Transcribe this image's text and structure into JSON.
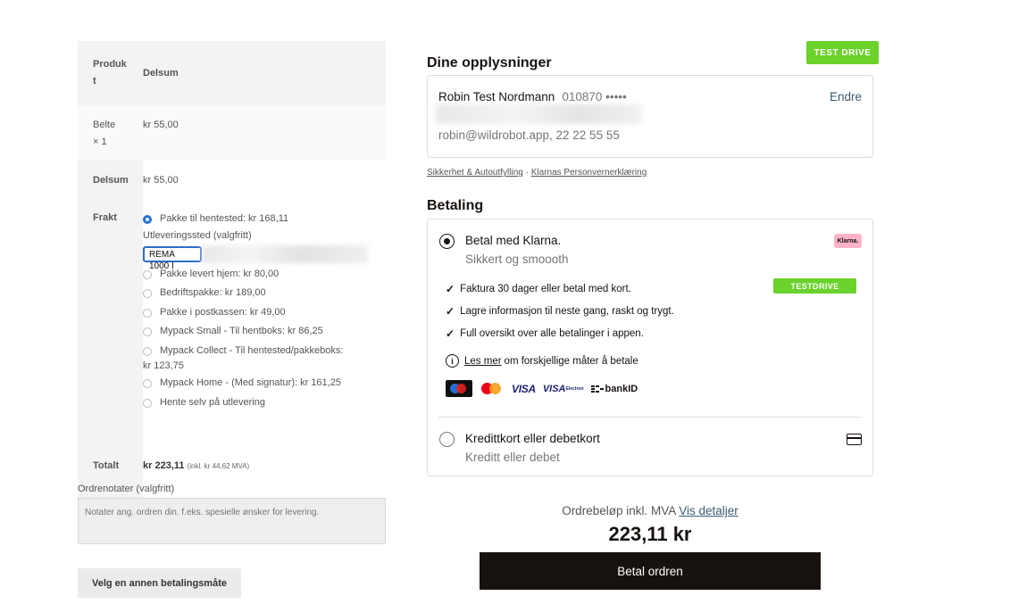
{
  "order": {
    "head_product": "Produk t",
    "head_product_l1": "Produk",
    "head_product_l2": "t",
    "head_subtotal": "Delsum",
    "item_name_l1": "Belte",
    "item_name_l2": "× 1",
    "item_price": "kr 55,00",
    "subtotal_label": "Delsum",
    "subtotal_value": "kr 55,00",
    "shipping_label": "Frakt",
    "shipping_options": [
      {
        "label": "Pakke til hentested: kr 168,11",
        "selected": true
      },
      {
        "label": "Pakke levert hjem: kr 80,00",
        "selected": false
      },
      {
        "label": "Bedriftspakke: kr 189,00",
        "selected": false
      },
      {
        "label": "Pakke i postkassen: kr 49,00",
        "selected": false
      },
      {
        "label": "Mypack Small - Til hentboks: kr 86,25",
        "selected": false
      },
      {
        "label": "Mypack Collect - Til hentested/pakkeboks:",
        "label_cont": "kr 123,75",
        "selected": false
      },
      {
        "label": "Mypack Home - (Med signatur): kr 161,25",
        "selected": false
      },
      {
        "label": "Hente selv på utlevering",
        "selected": false
      }
    ],
    "pickup_label": "Utleveringssted (valgfritt)",
    "pickup_value": "REMA 1000 I",
    "total_label": "Totalt",
    "total_value": "kr 223,11",
    "total_mva": "(inkl. kr 44,62 MVA)",
    "notes_label": "Ordrenotater (valgfritt)",
    "notes_placeholder": "Notater ang. ordren din. f.eks. spesielle ønsker for levering.",
    "alt_payment_button": "Velg en annen betalingsmåte"
  },
  "klarna": {
    "test_drive_badge": "TEST DRIVE",
    "info_title": "Dine opplysninger",
    "customer_name": "Robin Test Nordmann",
    "customer_pnr": "010870 •••••",
    "edit_link": "Endre",
    "customer_contact": "robin@wildrobot.app, 22 22 55 55",
    "legal_link_1": "Sikkerhet & Autoutfylling",
    "legal_sep": "·",
    "legal_link_2": "Klarnas Personvernerklæring",
    "payment_title": "Betaling",
    "method_1_title": "Betal med Klarna.",
    "method_1_sub": "Sikkert og smoooth",
    "klarna_badge": "Klarna.",
    "testdrive_small": "TESTDRIVE",
    "features": [
      "Faktura 30 dager eller betal med kort.",
      "Lagre informasjon til neste gang, raskt og trygt.",
      "Full oversikt over alle betalinger i appen."
    ],
    "learn_more_link": "Les mer",
    "learn_more_text": "om forskjellige måter å betale",
    "logo_visa": "VISA",
    "logo_visa_small": "VISA",
    "logo_visa_small_sub": "Electron",
    "logo_bankid": "bankID",
    "method_2_title": "Kredittkort eller debetkort",
    "method_2_sub": "Kreditt eller debet",
    "amount_label": "Ordrebeløp inkl. MVA",
    "details_link": "Vis detaljer",
    "amount_value": "223,11 kr",
    "pay_button": "Betal ordren"
  },
  "icons": {
    "check": "✓",
    "info": "i",
    "card": "card-icon"
  },
  "colors": {
    "testdrive_green": "#6bd12b",
    "klarna_pink": "#ffb3c7",
    "radio_blue": "#2271d6",
    "pay_button_bg": "#17120f"
  }
}
